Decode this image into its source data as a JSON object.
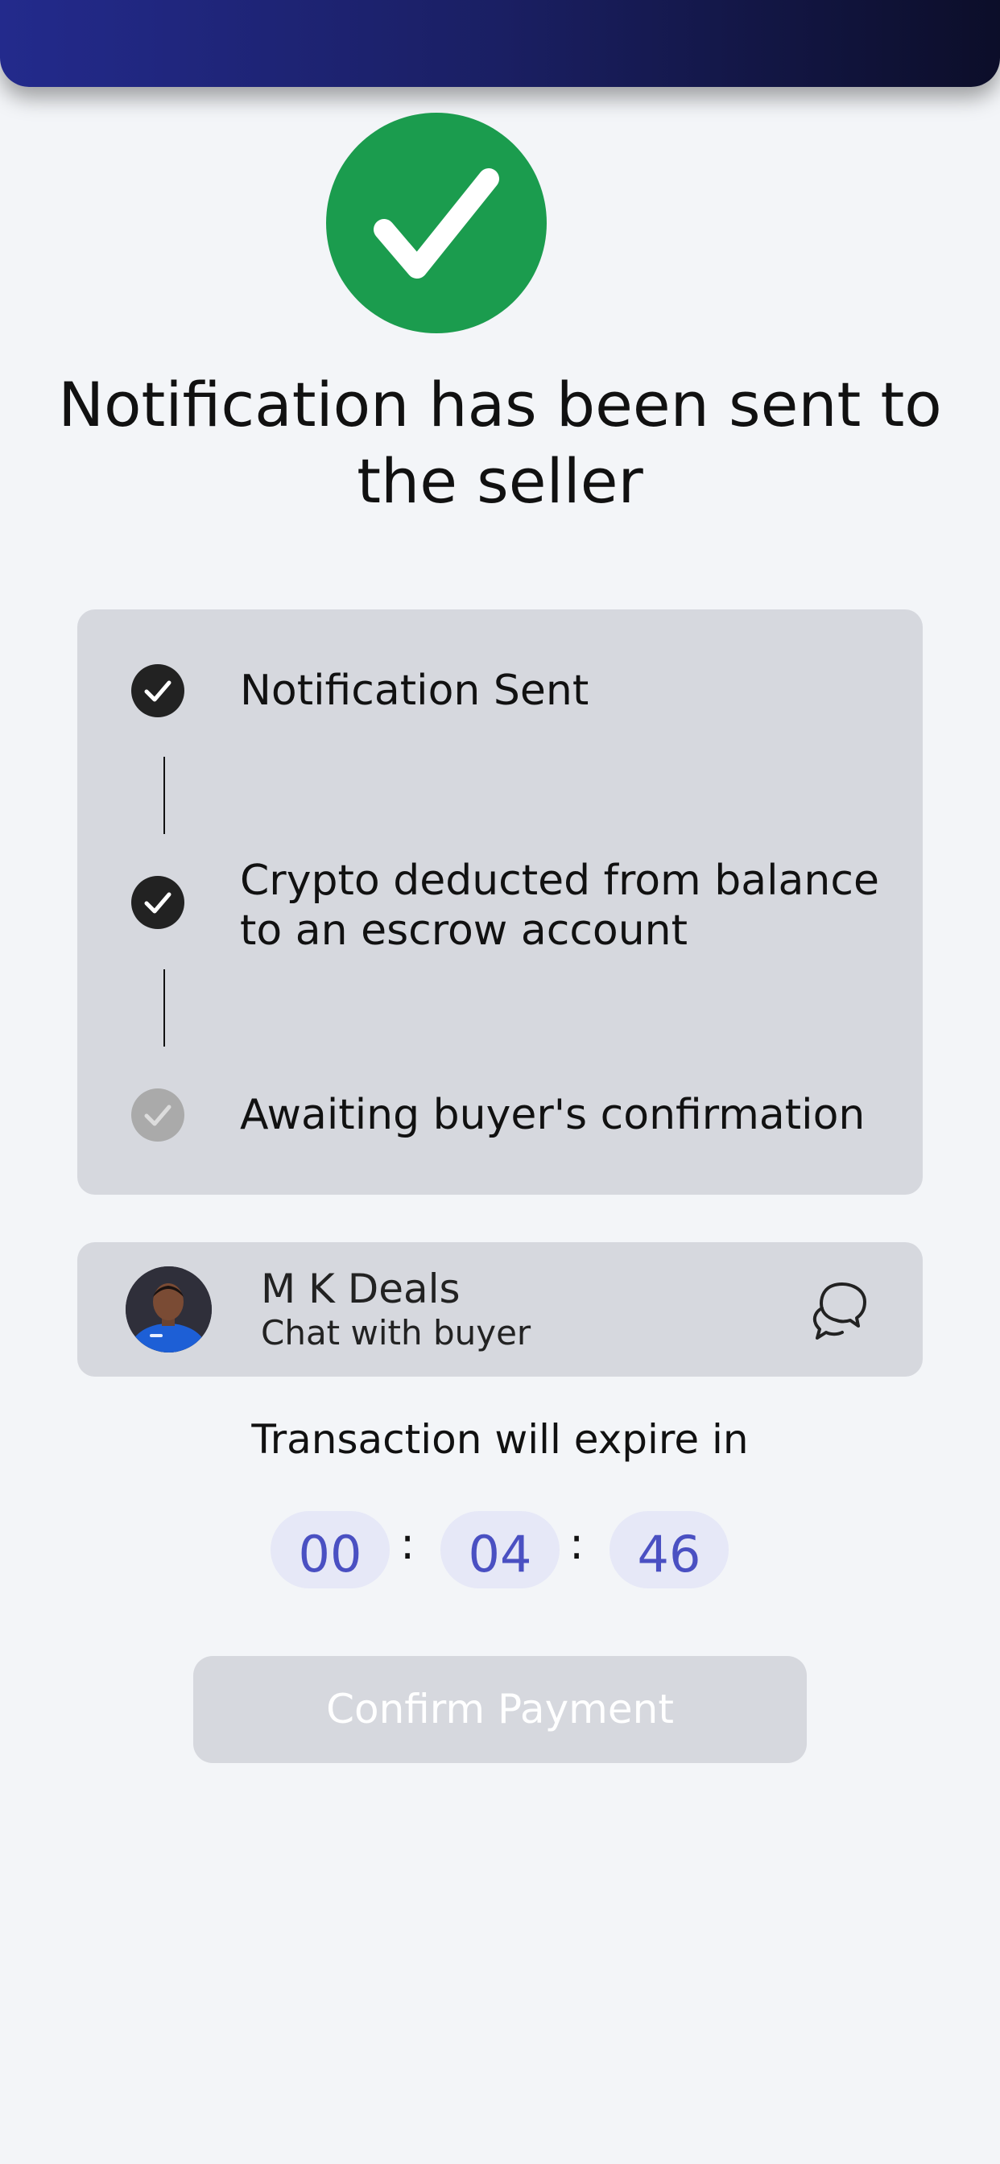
{
  "header": {
    "gradient_colors": [
      "#232a8c",
      "#0c0e29"
    ]
  },
  "success": {
    "icon": "checkmark-icon",
    "color": "#1b9c4e",
    "title": "Notification has been sent to the seller"
  },
  "steps": [
    {
      "label": "Notification Sent",
      "status": "done",
      "icon": "check-circle-icon"
    },
    {
      "label": "Crypto deducted from balance to an escrow account",
      "status": "done",
      "icon": "check-circle-icon"
    },
    {
      "label": "Awaiting buyer's confirmation",
      "status": "pending",
      "icon": "check-circle-icon"
    }
  ],
  "buyer": {
    "name": "M K Deals",
    "subtitle": "Chat with buyer",
    "avatar_icon": "avatar",
    "chat_icon": "chat-bubbles-icon"
  },
  "timer": {
    "label": "Transaction will expire in",
    "hours": "00",
    "minutes": "04",
    "seconds": "46",
    "separator": ":",
    "accent_color": "#4a50c2"
  },
  "actions": {
    "confirm_label": "Confirm Payment",
    "confirm_enabled": false
  }
}
